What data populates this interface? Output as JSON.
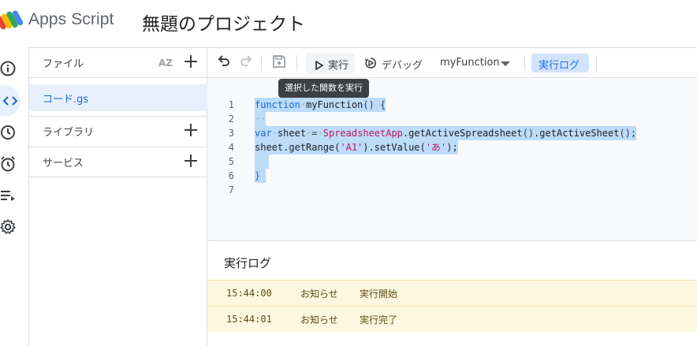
{
  "header": {
    "app_name": "Apps Script",
    "project_title": "無題のプロジェクト"
  },
  "rail": {
    "items": [
      "info-icon",
      "code-icon",
      "history-icon",
      "clock-icon",
      "playlist-icon",
      "gear-icon"
    ],
    "active": "code-icon"
  },
  "files": {
    "header_label": "ファイル",
    "sort_label": "AZ",
    "items": [
      {
        "name": "コード.gs"
      }
    ],
    "sections": [
      {
        "label": "ライブラリ"
      },
      {
        "label": "サービス"
      }
    ]
  },
  "toolbar": {
    "run_label": "実行",
    "debug_label": "デバッグ",
    "function_select": "myFunction",
    "log_label": "実行ログ",
    "tooltip": "選択した関数を実行"
  },
  "editor": {
    "line_numbers": [
      "1",
      "2",
      "3",
      "4",
      "5",
      "6",
      "7"
    ],
    "code": {
      "l1_kw": "function",
      "l1_name": "myFunction",
      "l1_rest": "() {",
      "l2_ws": "··",
      "l3_kw": "var",
      "l3_var": "sheet",
      "l3_eq": "=",
      "l3_cls": "SpreadsheetApp",
      "l3_m1": ".getActiveSpreadsheet",
      "l3_p1": "()",
      "l3_m2": ".getActiveSheet",
      "l3_p2": "();",
      "l4_a": "sheet.getRange(",
      "l4_s1": "'A1'",
      "l4_b": ").setValue(",
      "l4_s2": "'あ'",
      "l4_c": ");",
      "l6": "}"
    }
  },
  "log": {
    "title": "実行ログ",
    "rows": [
      {
        "time": "15:44:00",
        "level": "お知らせ",
        "message": "実行開始"
      },
      {
        "time": "15:44:01",
        "level": "お知らせ",
        "message": "実行完了"
      }
    ]
  },
  "colors": {
    "accent": "#1a73e8",
    "selection": "#bcdcfa",
    "log_row_bg": "#fef7e0"
  }
}
